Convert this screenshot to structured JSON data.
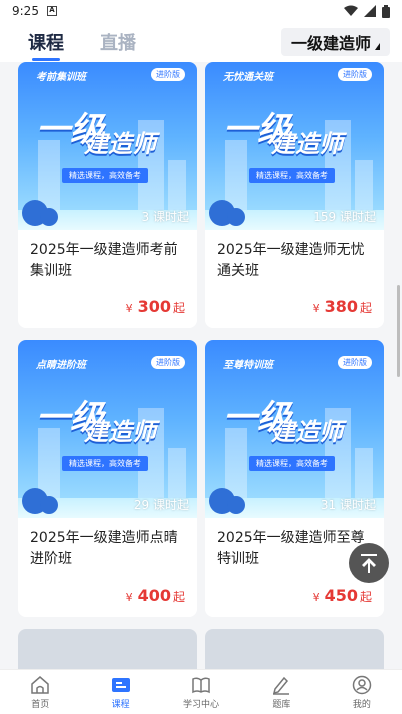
{
  "status_bar": {
    "time": "9:25",
    "sim_label": "A"
  },
  "header": {
    "tabs": [
      {
        "label": "课程",
        "active": true
      },
      {
        "label": "直播",
        "active": false
      }
    ],
    "exam_selector": "一级建造师"
  },
  "banner_common": {
    "version_badge": "进阶版",
    "headline_1": "一级",
    "headline_2": "建造师",
    "slogan": "精选课程，高效备考"
  },
  "courses": [
    {
      "tag": "考前集训班",
      "lessons": "3 课时起",
      "title": "2025年一级建造师考前集训班",
      "currency": "¥",
      "price": "300",
      "price_suffix": "起"
    },
    {
      "tag": "无忧通关班",
      "lessons": "159 课时起",
      "title": "2025年一级建造师无忧通关班",
      "currency": "¥",
      "price": "380",
      "price_suffix": "起"
    },
    {
      "tag": "点睛进阶班",
      "lessons": "29 课时起",
      "title": "2025年一级建造师点晴进阶班",
      "currency": "¥",
      "price": "400",
      "price_suffix": "起"
    },
    {
      "tag": "至尊特训班",
      "lessons": "31 课时起",
      "title": "2025年一级建造师至尊特训班",
      "currency": "¥",
      "price": "450",
      "price_suffix": "起"
    }
  ],
  "bottom_nav": [
    {
      "label": "首页",
      "icon": "home-icon",
      "active": false
    },
    {
      "label": "课程",
      "icon": "course-icon",
      "active": true
    },
    {
      "label": "学习中心",
      "icon": "book-icon",
      "active": false
    },
    {
      "label": "题库",
      "icon": "pencil-icon",
      "active": false
    },
    {
      "label": "我的",
      "icon": "user-icon",
      "active": false
    }
  ],
  "colors": {
    "accent": "#2e74ff",
    "price": "#e53935"
  }
}
